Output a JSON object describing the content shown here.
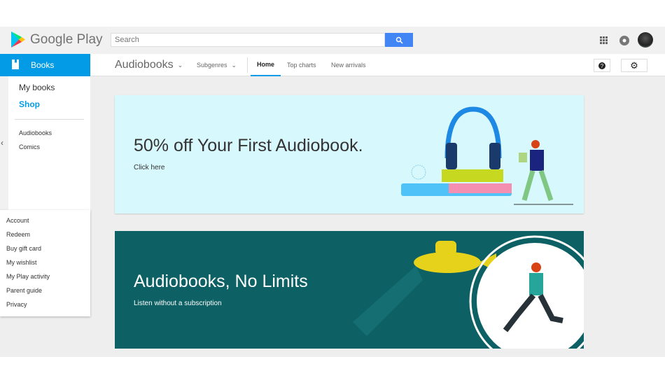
{
  "header": {
    "logo": "Google Play",
    "search_placeholder": "Search",
    "icons": [
      "apps-icon",
      "notifications-icon",
      "avatar"
    ]
  },
  "nav": {
    "section": "Books",
    "category": "Audiobooks",
    "subgenres": "Subgenres",
    "tabs": [
      "Home",
      "Top charts",
      "New arrivals"
    ],
    "active_tab": "Home"
  },
  "sidebar": {
    "top": [
      "My books",
      "Shop"
    ],
    "active": "Shop",
    "genres": [
      "Audiobooks",
      "Comics"
    ],
    "bottom": [
      "Account",
      "Redeem",
      "Buy gift card",
      "My wishlist",
      "My Play activity",
      "Parent guide",
      "Privacy"
    ]
  },
  "banners": [
    {
      "title": "50% off Your First Audiobook.",
      "subtitle": "Click here",
      "color": "#d7f8fc"
    },
    {
      "title": "Audiobooks, No Limits",
      "subtitle": "Listen without a subscription",
      "color": "#0d6063"
    }
  ],
  "colors": {
    "accent": "#039be5",
    "search": "#4285f4"
  }
}
